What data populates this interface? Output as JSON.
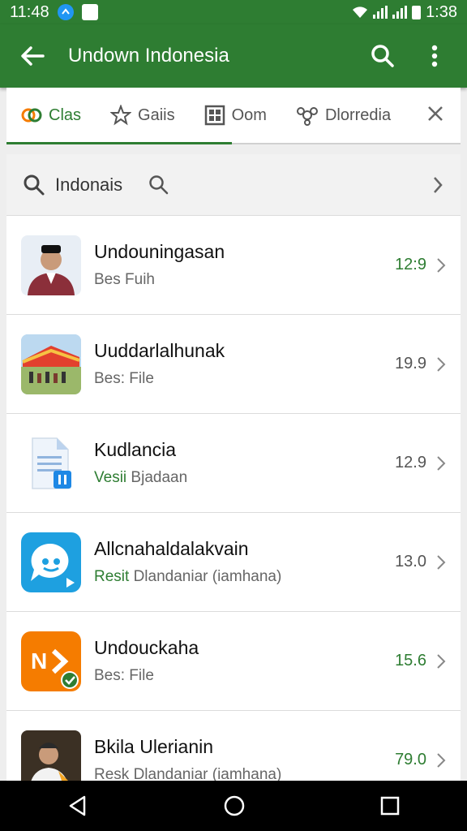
{
  "status": {
    "time_left": "11:48",
    "time_right": "1:38"
  },
  "appbar": {
    "title": "Undown Indonesia"
  },
  "tabs": [
    {
      "label": "Clas"
    },
    {
      "label": "Gaiis"
    },
    {
      "label": "Oom"
    },
    {
      "label": "Dlorredia"
    }
  ],
  "search": {
    "label": "Indonais"
  },
  "items": [
    {
      "title": "Undouningasan",
      "sub_highlight": "",
      "sub": "Bes Fuih",
      "value": "12:9",
      "value_color": "green"
    },
    {
      "title": "Uuddarlalhunak",
      "sub_highlight": "",
      "sub": "Bes: File",
      "value": "19.9",
      "value_color": "gray"
    },
    {
      "title": "Kudlancia",
      "sub_highlight": "Vesii",
      "sub": "Bjadaan",
      "value": "12.9",
      "value_color": "gray"
    },
    {
      "title": "Allcnahaldalakvain",
      "sub_highlight": "Resit",
      "sub": "Dlandaniar (iamhana)",
      "value": "13.0",
      "value_color": "gray"
    },
    {
      "title": "Undouckaha",
      "sub_highlight": "",
      "sub": "Bes: File",
      "value": "15.6",
      "value_color": "green"
    },
    {
      "title": "Bkila Ulerianin",
      "sub_highlight": "",
      "sub": "Resk Dlandaniar (iamhana)",
      "value": "79.0",
      "value_color": "green"
    }
  ],
  "colors": {
    "primary": "#2e7d32",
    "accent_blue": "#2196f3",
    "accent_orange": "#f57c00"
  }
}
